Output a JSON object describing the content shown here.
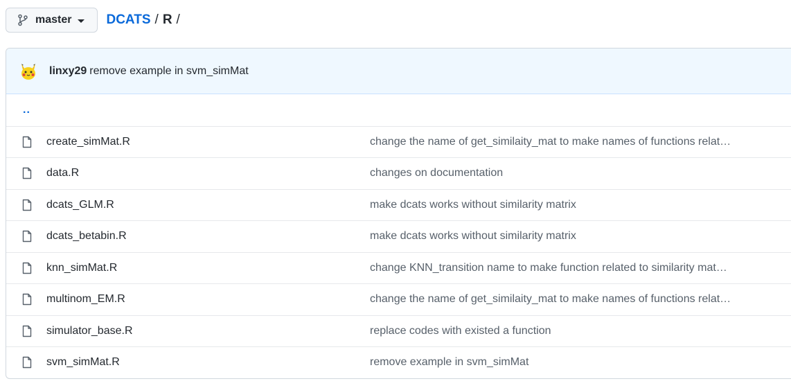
{
  "branch": {
    "icon": "git-branch-icon",
    "label": "master"
  },
  "breadcrumb": {
    "repo": "DCATS",
    "separator1": "/",
    "dir": "R",
    "separator2": "/"
  },
  "latest_commit": {
    "author": "linxy29",
    "message": "remove example in svm_simMat",
    "avatar": "pikachu-avatar"
  },
  "parent_dir": "..",
  "files": [
    {
      "name": "create_simMat.R",
      "message": "change the name of get_similaity_mat to make names of functions relat…"
    },
    {
      "name": "data.R",
      "message": "changes on documentation"
    },
    {
      "name": "dcats_GLM.R",
      "message": "make dcats works without similarity matrix"
    },
    {
      "name": "dcats_betabin.R",
      "message": "make dcats works without similarity matrix"
    },
    {
      "name": "knn_simMat.R",
      "message": "change KNN_transition name to make function related to similarity mat…"
    },
    {
      "name": "multinom_EM.R",
      "message": "change the name of get_similaity_mat to make names of functions relat…"
    },
    {
      "name": "simulator_base.R",
      "message": "replace codes with existed a function"
    },
    {
      "name": "svm_simMat.R",
      "message": "remove example in svm_simMat"
    }
  ],
  "colors": {
    "link": "#0969da",
    "commit_bg": "#eff8ff",
    "border": "#d0d7de"
  }
}
